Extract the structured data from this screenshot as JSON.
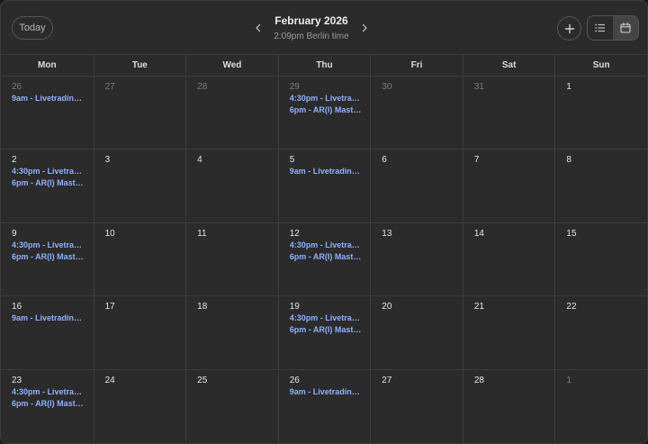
{
  "header": {
    "today_label": "Today",
    "month_title": "February 2026",
    "timezone_text": "2:09pm Berlin time"
  },
  "colors": {
    "background": "#2b2b2b",
    "border": "#3c3c3c",
    "event_text": "#8fb0ff",
    "active_view": "#454545"
  },
  "icons": {
    "prev": "chevron-left-icon",
    "next": "chevron-right-icon",
    "add": "plus-icon",
    "list_view": "list-icon",
    "month_view": "calendar-icon"
  },
  "active_view": "month",
  "weekdays": [
    "Mon",
    "Tue",
    "Wed",
    "Thu",
    "Fri",
    "Sat",
    "Sun"
  ],
  "weeks": [
    [
      {
        "day": "26",
        "muted": true,
        "events": [
          "9am - Livetrading ..."
        ]
      },
      {
        "day": "27",
        "muted": true,
        "events": []
      },
      {
        "day": "28",
        "muted": true,
        "events": []
      },
      {
        "day": "29",
        "muted": true,
        "events": [
          "4:30pm - Livetradi...",
          "6pm - AR(I) Maste..."
        ]
      },
      {
        "day": "30",
        "muted": true,
        "events": []
      },
      {
        "day": "31",
        "muted": true,
        "events": []
      },
      {
        "day": "1",
        "muted": false,
        "events": []
      }
    ],
    [
      {
        "day": "2",
        "muted": false,
        "events": [
          "4:30pm - Livetradi...",
          "6pm - AR(I) Maste..."
        ]
      },
      {
        "day": "3",
        "muted": false,
        "events": []
      },
      {
        "day": "4",
        "muted": false,
        "events": []
      },
      {
        "day": "5",
        "muted": false,
        "events": [
          "9am - Livetrading ..."
        ]
      },
      {
        "day": "6",
        "muted": false,
        "events": []
      },
      {
        "day": "7",
        "muted": false,
        "events": []
      },
      {
        "day": "8",
        "muted": false,
        "events": []
      }
    ],
    [
      {
        "day": "9",
        "muted": false,
        "events": [
          "4:30pm - Livetradi...",
          "6pm - AR(I) Maste..."
        ]
      },
      {
        "day": "10",
        "muted": false,
        "events": []
      },
      {
        "day": "11",
        "muted": false,
        "events": []
      },
      {
        "day": "12",
        "muted": false,
        "events": [
          "4:30pm - Livetradi...",
          "6pm - AR(I) Maste..."
        ]
      },
      {
        "day": "13",
        "muted": false,
        "events": []
      },
      {
        "day": "14",
        "muted": false,
        "events": []
      },
      {
        "day": "15",
        "muted": false,
        "events": []
      }
    ],
    [
      {
        "day": "16",
        "muted": false,
        "events": [
          "9am - Livetrading ..."
        ]
      },
      {
        "day": "17",
        "muted": false,
        "events": []
      },
      {
        "day": "18",
        "muted": false,
        "events": []
      },
      {
        "day": "19",
        "muted": false,
        "events": [
          "4:30pm - Livetradi...",
          "6pm - AR(I) Maste..."
        ]
      },
      {
        "day": "20",
        "muted": false,
        "events": []
      },
      {
        "day": "21",
        "muted": false,
        "events": []
      },
      {
        "day": "22",
        "muted": false,
        "events": []
      }
    ],
    [
      {
        "day": "23",
        "muted": false,
        "events": [
          "4:30pm - Livetradi...",
          "6pm - AR(I) Maste..."
        ]
      },
      {
        "day": "24",
        "muted": false,
        "events": []
      },
      {
        "day": "25",
        "muted": false,
        "events": []
      },
      {
        "day": "26",
        "muted": false,
        "events": [
          "9am - Livetrading ..."
        ]
      },
      {
        "day": "27",
        "muted": false,
        "events": []
      },
      {
        "day": "28",
        "muted": false,
        "events": []
      },
      {
        "day": "1",
        "muted": true,
        "events": []
      }
    ]
  ]
}
